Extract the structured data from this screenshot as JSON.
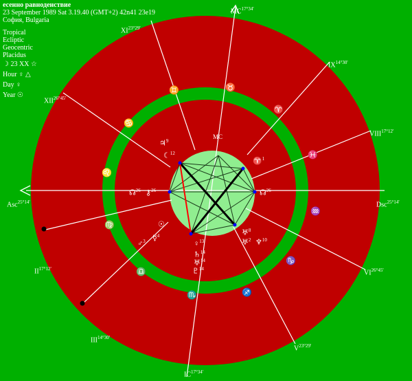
{
  "header": {
    "title": "есенно равноденствие",
    "datetime": "23 September 1989  Sat   3.19.40 (GMT+2) 42n41  23e19",
    "place": "София, Bulgaria",
    "settings": [
      "Tropical",
      "Ecliptic",
      "Geocentric",
      "Placidus"
    ],
    "moon_phase": "☽  23 XX ☆",
    "hour_ruler": "Hour ♀  △",
    "day_ruler": "Day ♀",
    "year_ruler": "Year ☉"
  },
  "angles": {
    "asc": {
      "name": "Asc",
      "deg": "25°14'"
    },
    "dsc": {
      "name": "Dsc",
      "deg": "25°14'"
    },
    "mc": {
      "name": "MC",
      "deg": "17°34'"
    },
    "ic": {
      "name": "IC",
      "deg": "17°34'"
    }
  },
  "house_cusps": [
    {
      "num": "II",
      "deg": "17°12'"
    },
    {
      "num": "III",
      "deg": "14°30'"
    },
    {
      "num": "V",
      "deg": "23°29'"
    },
    {
      "num": "VI",
      "deg": "26°45'"
    },
    {
      "num": "VIII",
      "deg": "17°12'"
    },
    {
      "num": "IX",
      "deg": "14°30'"
    },
    {
      "num": "XI",
      "deg": "23°29'"
    },
    {
      "num": "XII",
      "deg": "26°45'"
    }
  ],
  "zodiac_glyphs": [
    "♈",
    "♉",
    "♊",
    "♋",
    "♌",
    "♍",
    "♎",
    "♏",
    "♐",
    "♑",
    "♒",
    "♓"
  ],
  "planets": [
    {
      "glyph": "♃",
      "deg": "9"
    },
    {
      "glyph": "☾",
      "deg": "12"
    },
    {
      "glyph": "☊",
      "deg": "26"
    },
    {
      "glyph": "⚷",
      "deg": "26"
    },
    {
      "glyph": "☊",
      "deg": "26"
    },
    {
      "glyph": "☉",
      "deg": ""
    },
    {
      "glyph": "☿",
      "deg": "4"
    },
    {
      "glyph": "♂",
      "deg": "3"
    },
    {
      "glyph": "♀",
      "deg": "13"
    },
    {
      "glyph": "♄",
      "deg": "14"
    },
    {
      "glyph": "♅",
      "deg": "14"
    },
    {
      "glyph": "♇",
      "deg": "14"
    },
    {
      "glyph": "♈",
      "deg": "1"
    },
    {
      "glyph": "♅",
      "deg": "8"
    },
    {
      "glyph": "♅",
      "deg": "2"
    },
    {
      "glyph": "♆",
      "deg": "10"
    }
  ],
  "colors": {
    "background": "#00b000",
    "house_ring": "#c00000",
    "zodiac_band": "#00b000",
    "center_circle": "#90ee90",
    "line": "#ffffff",
    "aspect_red": "#ff0000"
  }
}
